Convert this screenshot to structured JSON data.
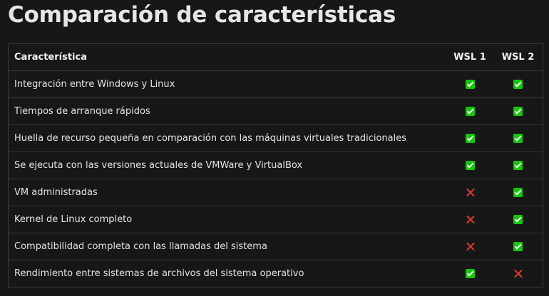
{
  "title": "Comparación de características",
  "table": {
    "headers": {
      "feature": "Característica",
      "wsl1": "WSL 1",
      "wsl2": "WSL 2"
    },
    "rows": [
      {
        "feature": "Integración entre Windows y Linux",
        "wsl1": "check-icon",
        "wsl2": "check-icon"
      },
      {
        "feature": "Tiempos de arranque rápidos",
        "wsl1": "check-icon",
        "wsl2": "check-icon"
      },
      {
        "feature": "Huella de recurso pequeña en comparación con las máquinas virtuales tradicionales",
        "wsl1": "check-icon",
        "wsl2": "check-icon"
      },
      {
        "feature": "Se ejecuta con las versiones actuales de VMWare y VirtualBox",
        "wsl1": "check-icon",
        "wsl2": "check-icon"
      },
      {
        "feature": "VM administradas",
        "wsl1": "cross-icon",
        "wsl2": "check-icon"
      },
      {
        "feature": "Kernel de Linux completo",
        "wsl1": "cross-icon",
        "wsl2": "check-icon"
      },
      {
        "feature": "Compatibilidad completa con las llamadas del sistema",
        "wsl1": "cross-icon",
        "wsl2": "check-icon"
      },
      {
        "feature": "Rendimiento entre sistemas de archivos del sistema operativo",
        "wsl1": "check-icon",
        "wsl2": "cross-icon"
      }
    ]
  },
  "colors": {
    "check": "#16c60c",
    "cross": "#e8382c",
    "background": "#171717",
    "border": "#3b3b3b"
  }
}
